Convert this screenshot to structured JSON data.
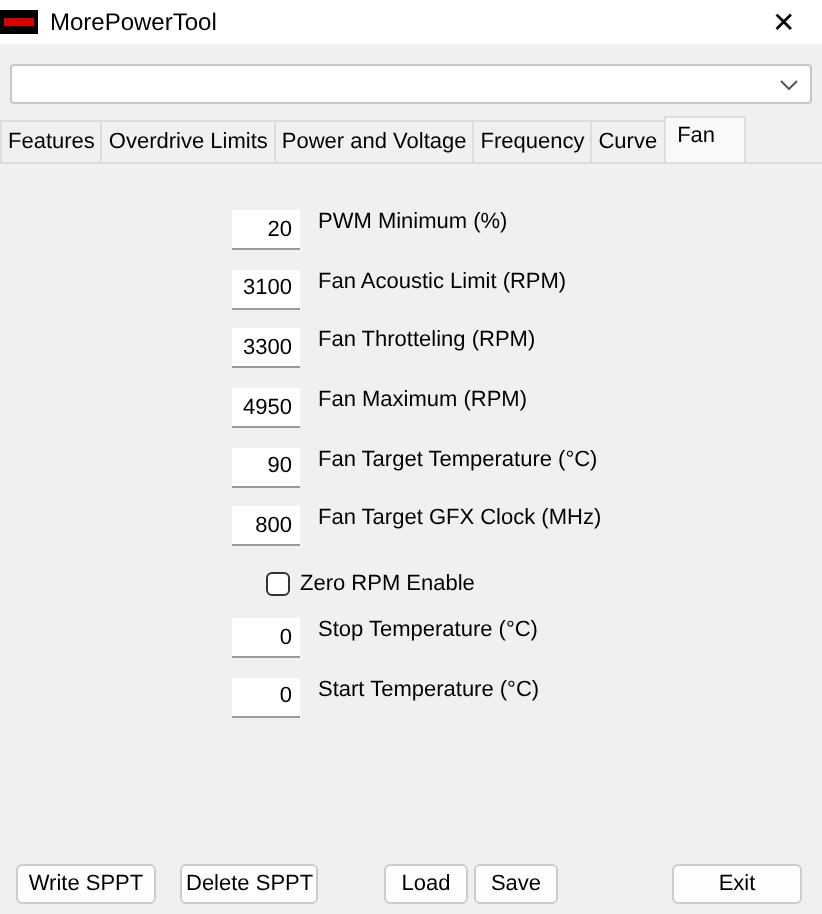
{
  "window": {
    "title": "MorePowerTool",
    "close": "✕"
  },
  "tabs": [
    {
      "label": "Features",
      "selected": false
    },
    {
      "label": "Overdrive Limits",
      "selected": false
    },
    {
      "label": "Power and Voltage",
      "selected": false
    },
    {
      "label": "Frequency",
      "selected": false
    },
    {
      "label": "Curve",
      "selected": false
    },
    {
      "label": "Fan",
      "selected": true
    }
  ],
  "fan_settings": [
    {
      "kind": "field",
      "value": "20",
      "label": "PWM Minimum (%)"
    },
    {
      "kind": "field",
      "value": "3100",
      "label": "Fan Acoustic Limit (RPM)"
    },
    {
      "kind": "field",
      "value": "3300",
      "label": "Fan Throtteling (RPM)"
    },
    {
      "kind": "field",
      "value": "4950",
      "label": "Fan Maximum (RPM)"
    },
    {
      "kind": "field",
      "value": "90",
      "label": "Fan Target Temperature (°C)"
    },
    {
      "kind": "field",
      "value": "800",
      "label": "Fan Target GFX Clock (MHz)"
    },
    {
      "kind": "checkbox",
      "label": "Zero RPM Enable",
      "checked": false
    },
    {
      "kind": "field",
      "value": "0",
      "label": "Stop Temperature (°C)"
    },
    {
      "kind": "field",
      "value": "0",
      "label": "Start Temperature (°C)"
    }
  ],
  "buttons": [
    "Write SPPT",
    "Delete SPPT",
    "Load",
    "Save",
    "Exit"
  ]
}
